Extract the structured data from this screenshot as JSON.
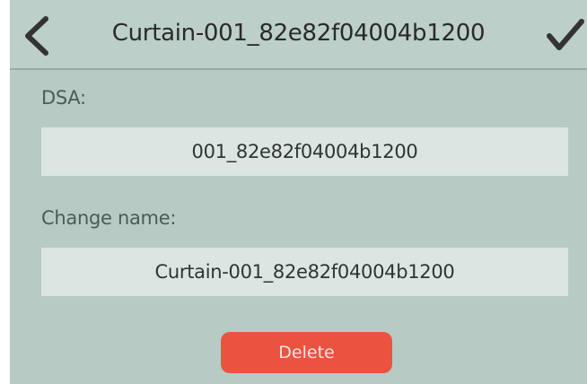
{
  "header": {
    "title": "Curtain-001_82e82f04004b1200",
    "back_icon": "chevron-left-icon",
    "confirm_icon": "checkmark-icon"
  },
  "dsa": {
    "label": "DSA:",
    "value": "001_82e82f04004b1200"
  },
  "rename": {
    "label": "Change name:",
    "value": "Curtain-001_82e82f04004b1200"
  },
  "actions": {
    "delete_label": "Delete"
  },
  "colors": {
    "background": "#b7cbc4",
    "field_background": "#dbe6e2",
    "delete_button": "#ec5240"
  }
}
